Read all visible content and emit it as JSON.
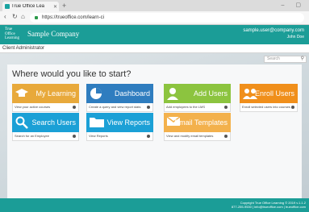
{
  "browser": {
    "tab_title": "True Office Lea",
    "url": "https://trueoffice.com/learn-ci"
  },
  "header": {
    "logo": [
      "True",
      "Office",
      "Learning"
    ],
    "company": "Sample Company",
    "user_email": "sample.user@company.com",
    "user_name": "John Doe"
  },
  "role": "Client Administrator",
  "search": {
    "placeholder": "Search"
  },
  "main": {
    "heading": "Where would you like to start?",
    "tiles": [
      {
        "label": "My Learning",
        "desc": "View your active courses",
        "color": "#e8a93b",
        "icon": "graduation-cap-icon"
      },
      {
        "label": "Dashboard",
        "desc": "Create a query and view report stats",
        "color": "#2f7dbf",
        "icon": "pie-chart-icon"
      },
      {
        "label": "Add Users",
        "desc": "Add employees to the LMS",
        "color": "#8cc43f",
        "icon": "add-user-icon"
      },
      {
        "label": "Enroll Users",
        "desc": "Enroll selected users into courses",
        "color": "#f08f1b",
        "icon": "users-group-icon"
      },
      {
        "label": "Search Users",
        "desc": "Search for an Employee",
        "color": "#1ba0d6",
        "icon": "search-icon"
      },
      {
        "label": "View Reports",
        "desc": "View Reports",
        "color": "#1ba0d6",
        "icon": "folder-icon"
      },
      {
        "label": "Email Templates",
        "desc": "View and modify email templates",
        "color": "#f3b14c",
        "icon": "envelope-icon"
      }
    ]
  },
  "footer": {
    "line1": "Copyright True Office Learning © 2019 v.1.1.2",
    "line2": "877-255-9530 | info@trueoffice.com | trueoffice.com"
  }
}
